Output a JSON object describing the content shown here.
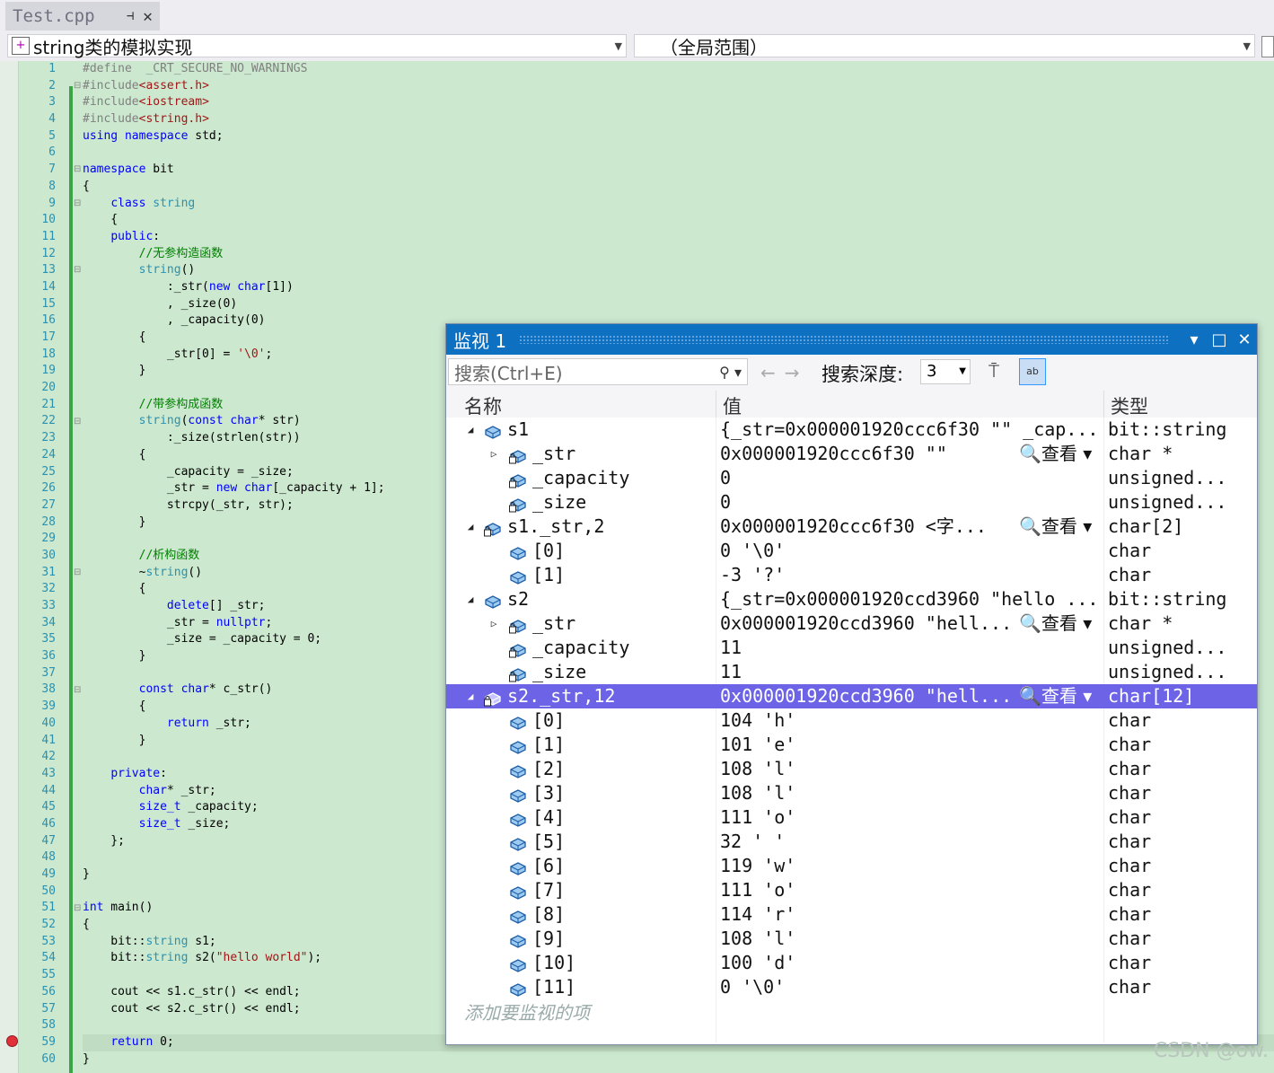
{
  "tab": {
    "title": "Test.cpp",
    "pin": "⊣",
    "close": "✕"
  },
  "nav": {
    "scope_left": "string类的模拟实现",
    "scope_right": "（全局范围）"
  },
  "code_lines": [
    "#define  _CRT_SECURE_NO_WARNINGS",
    "#include<assert.h>",
    "#include<iostream>",
    "#include<string.h>",
    "using namespace std;",
    "",
    "namespace bit",
    "{",
    "    class string",
    "    {",
    "    public:",
    "        //无参构造函数",
    "        string()",
    "            :_str(new char[1])",
    "            , _size(0)",
    "            , _capacity(0)",
    "        {",
    "            _str[0] = '\\0';",
    "        }",
    "",
    "        //带参构成函数",
    "        string(const char* str)",
    "            :_size(strlen(str))",
    "        {",
    "            _capacity = _size;",
    "            _str = new char[_capacity + 1];",
    "            strcpy(_str, str);",
    "        }",
    "",
    "        //析构函数",
    "        ~string()",
    "        {",
    "            delete[] _str;",
    "            _str = nullptr;",
    "            _size = _capacity = 0;",
    "        }",
    "",
    "        const char* c_str()",
    "        {",
    "            return _str;",
    "        }",
    "",
    "    private:",
    "        char* _str;",
    "        size_t _capacity;",
    "        size_t _size;",
    "    };",
    "",
    "}",
    "",
    "int main()",
    "{",
    "    bit::string s1;",
    "    bit::string s2(\"hello world\");",
    "",
    "    cout << s1.c_str() << endl;",
    "    cout << s2.c_str() << endl;",
    "",
    "    return 0;",
    "}"
  ],
  "watch": {
    "title": "监视 1",
    "search_placeholder": "搜索(Ctrl+E)",
    "depth_label": "搜索深度:",
    "depth_value": "3",
    "columns": {
      "name": "名称",
      "value": "值",
      "type": "类型"
    },
    "add_item": "添加要监视的项",
    "rows": [
      {
        "name": "s1",
        "value": "{_str=0x000001920ccc6f30 \"\" _cap...",
        "view": "",
        "type": "bit::string",
        "level": 0,
        "exp": "◢",
        "icon": "variable-icon"
      },
      {
        "name": "_str",
        "value": "0x000001920ccc6f30 \"\"",
        "view": "🔍查看 ▾",
        "type": "char *",
        "level": 1,
        "exp": "▷",
        "icon": "private-field-icon"
      },
      {
        "name": "_capacity",
        "value": "0",
        "view": "",
        "type": "unsigned...",
        "level": 1,
        "exp": "",
        "icon": "private-field-icon"
      },
      {
        "name": "_size",
        "value": "0",
        "view": "",
        "type": "unsigned...",
        "level": 1,
        "exp": "",
        "icon": "private-field-icon"
      },
      {
        "name": "s1._str,2",
        "value": "0x000001920ccc6f30  <字...",
        "view": "🔍查看 ▾",
        "type": "char[2]",
        "level": 0,
        "exp": "◢",
        "icon": "private-field-icon"
      },
      {
        "name": "[0]",
        "value": "0 '\\0'",
        "view": "",
        "type": "char",
        "level": 1,
        "exp": "",
        "icon": "variable-icon"
      },
      {
        "name": "[1]",
        "value": "-3 '?'",
        "view": "",
        "type": "char",
        "level": 1,
        "exp": "",
        "icon": "variable-icon"
      },
      {
        "name": "s2",
        "value": "{_str=0x000001920ccd3960 \"hello ...",
        "view": "",
        "type": "bit::string",
        "level": 0,
        "exp": "◢",
        "icon": "variable-icon"
      },
      {
        "name": "_str",
        "value": "0x000001920ccd3960 \"hell...",
        "view": "🔍查看 ▾",
        "type": "char *",
        "level": 1,
        "exp": "▷",
        "icon": "private-field-icon"
      },
      {
        "name": "_capacity",
        "value": "11",
        "view": "",
        "type": "unsigned...",
        "level": 1,
        "exp": "",
        "icon": "private-field-icon"
      },
      {
        "name": "_size",
        "value": "11",
        "view": "",
        "type": "unsigned...",
        "level": 1,
        "exp": "",
        "icon": "private-field-icon"
      },
      {
        "name": "s2._str,12",
        "value": "0x000001920ccd3960 \"hell...",
        "view": "🔍查看 ▾",
        "type": "char[12]",
        "level": 0,
        "exp": "◢",
        "icon": "private-field-icon",
        "selected": true
      },
      {
        "name": "[0]",
        "value": "104 'h'",
        "view": "",
        "type": "char",
        "level": 1,
        "exp": "",
        "icon": "variable-icon"
      },
      {
        "name": "[1]",
        "value": "101 'e'",
        "view": "",
        "type": "char",
        "level": 1,
        "exp": "",
        "icon": "variable-icon"
      },
      {
        "name": "[2]",
        "value": "108 'l'",
        "view": "",
        "type": "char",
        "level": 1,
        "exp": "",
        "icon": "variable-icon"
      },
      {
        "name": "[3]",
        "value": "108 'l'",
        "view": "",
        "type": "char",
        "level": 1,
        "exp": "",
        "icon": "variable-icon"
      },
      {
        "name": "[4]",
        "value": "111 'o'",
        "view": "",
        "type": "char",
        "level": 1,
        "exp": "",
        "icon": "variable-icon"
      },
      {
        "name": "[5]",
        "value": "32 ' '",
        "view": "",
        "type": "char",
        "level": 1,
        "exp": "",
        "icon": "variable-icon"
      },
      {
        "name": "[6]",
        "value": "119 'w'",
        "view": "",
        "type": "char",
        "level": 1,
        "exp": "",
        "icon": "variable-icon"
      },
      {
        "name": "[7]",
        "value": "111 'o'",
        "view": "",
        "type": "char",
        "level": 1,
        "exp": "",
        "icon": "variable-icon"
      },
      {
        "name": "[8]",
        "value": "114 'r'",
        "view": "",
        "type": "char",
        "level": 1,
        "exp": "",
        "icon": "variable-icon"
      },
      {
        "name": "[9]",
        "value": "108 'l'",
        "view": "",
        "type": "char",
        "level": 1,
        "exp": "",
        "icon": "variable-icon"
      },
      {
        "name": "[10]",
        "value": "100 'd'",
        "view": "",
        "type": "char",
        "level": 1,
        "exp": "",
        "icon": "variable-icon"
      },
      {
        "name": "[11]",
        "value": "0 '\\0'",
        "view": "",
        "type": "char",
        "level": 1,
        "exp": "",
        "icon": "variable-icon"
      }
    ]
  },
  "watermark": "CSDN @ow.",
  "colors": {
    "editor_bg": "#cce8cf",
    "title_bar": "#0e70c0",
    "selection": "#6d63e6",
    "keyword": "#0000ff",
    "comment": "#008000",
    "string": "#a31515"
  }
}
